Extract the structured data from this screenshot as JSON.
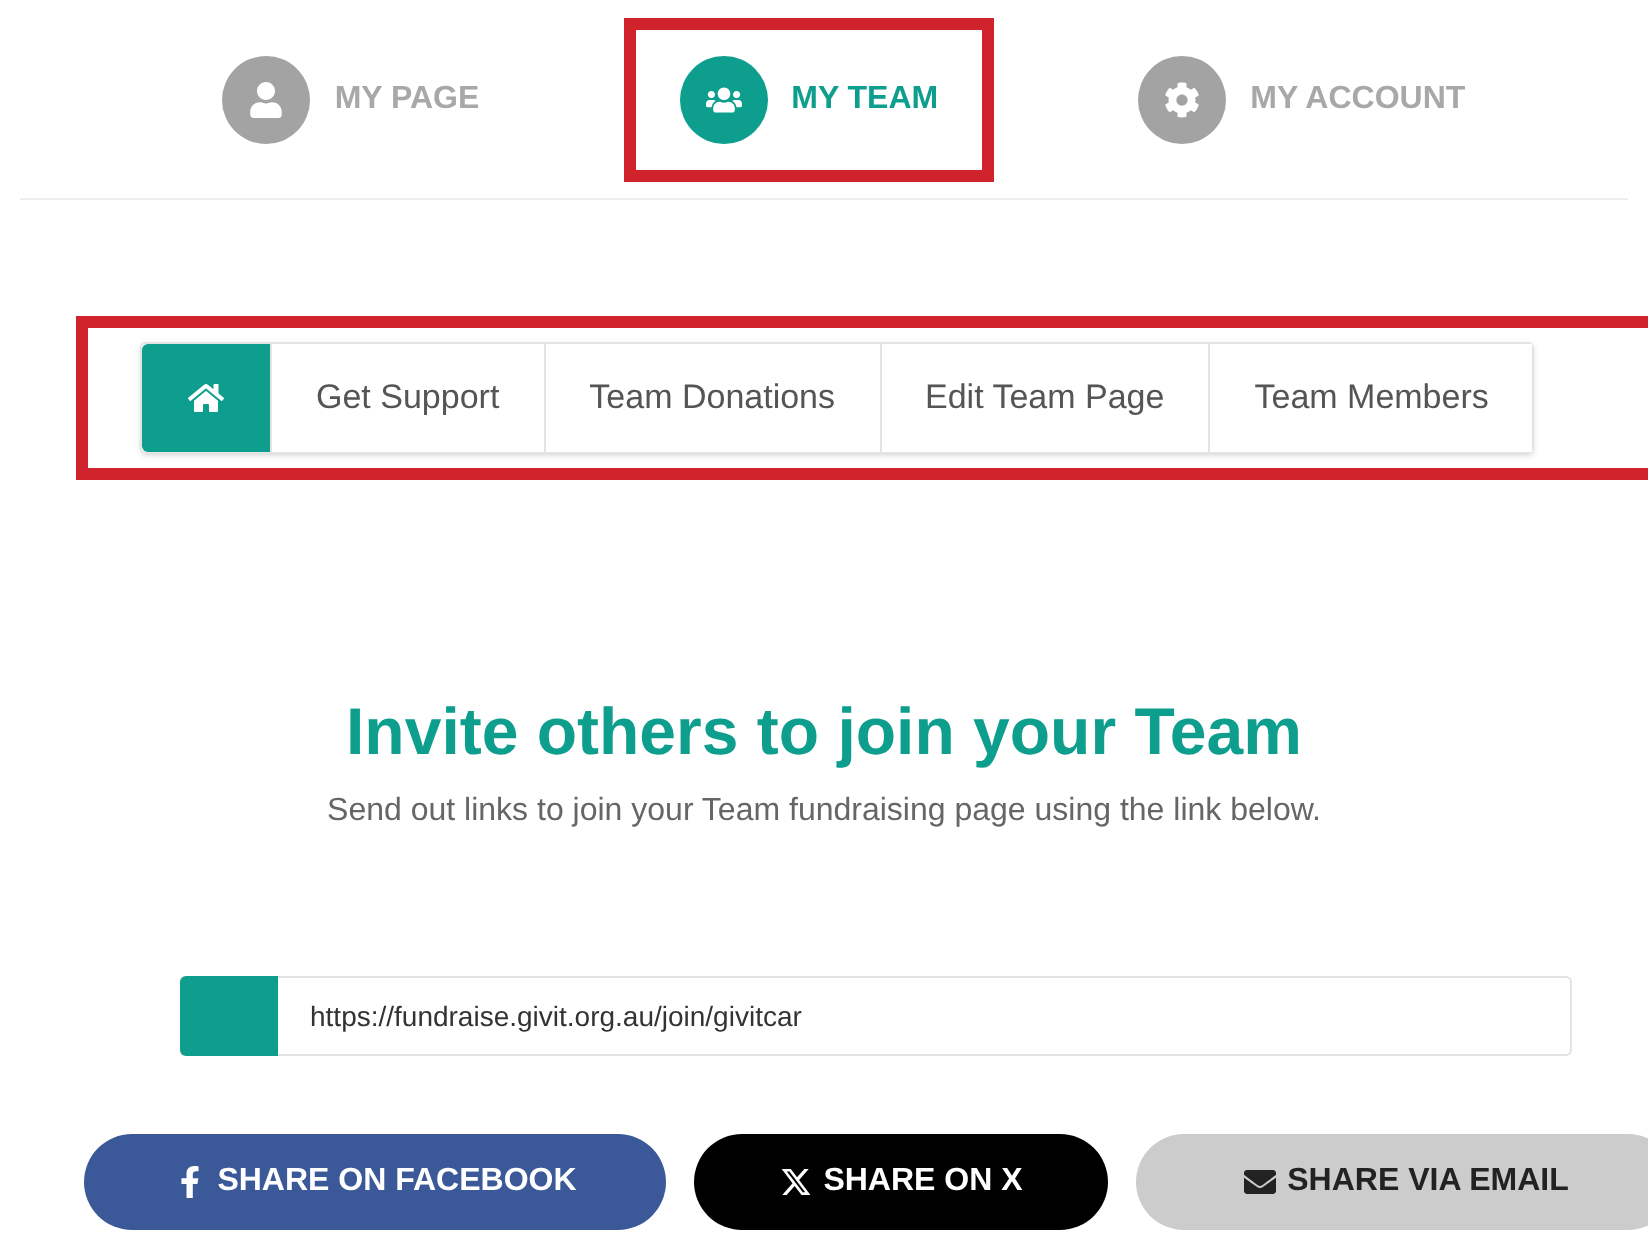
{
  "top_nav": [
    {
      "label": "MY PAGE",
      "kind": "user",
      "selected": false,
      "highlighted": false
    },
    {
      "label": "MY TEAM",
      "kind": "team",
      "selected": true,
      "highlighted": true
    },
    {
      "label": "MY ACCOUNT",
      "kind": "gear",
      "selected": false,
      "highlighted": false
    }
  ],
  "sub_nav": {
    "highlighted": true,
    "tabs": [
      {
        "kind": "home",
        "selected": true
      },
      {
        "kind": "text",
        "label": "Get Support",
        "selected": false
      },
      {
        "kind": "text",
        "label": "Team Donations",
        "selected": false
      },
      {
        "kind": "text",
        "label": "Edit Team Page",
        "selected": false
      },
      {
        "kind": "text",
        "label": "Team Members",
        "selected": false
      }
    ]
  },
  "heading": "Invite others to join your Team",
  "subtitle": "Send out links to join your Team fundraising page using the link below.",
  "link_field": {
    "value": "https://fundraise.givit.org.au/join/givitcar"
  },
  "share_buttons": [
    {
      "kind": "facebook",
      "label": "SHARE ON FACEBOOK"
    },
    {
      "kind": "x",
      "label": "SHARE ON X"
    },
    {
      "kind": "email",
      "label": "SHARE VIA EMAIL"
    }
  ]
}
